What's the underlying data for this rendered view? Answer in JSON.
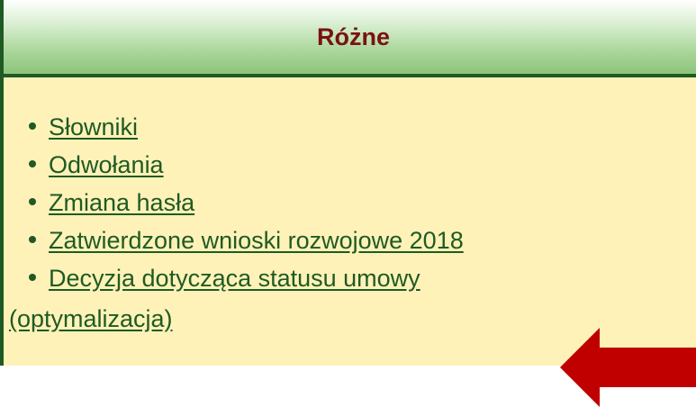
{
  "panel": {
    "title": "Różne",
    "items": [
      {
        "label": "Słowniki"
      },
      {
        "label": "Odwołania"
      },
      {
        "label": "Zmiana hasła"
      },
      {
        "label": "Zatwierdzone wnioski rozwojowe 2018"
      },
      {
        "label": "Decyzja dotycząca statusu umowy",
        "label_continued": "(optymalizacja)"
      }
    ]
  },
  "icons": {
    "bullet": "bullet-dot-icon",
    "pointer": "red-arrow-left-icon"
  },
  "colors": {
    "header_title": "#7a1212",
    "border_and_links": "#1f5a24",
    "body_background": "#fff2b8",
    "header_gradient_bottom": "#8cc47a",
    "arrow": "#c00000"
  }
}
